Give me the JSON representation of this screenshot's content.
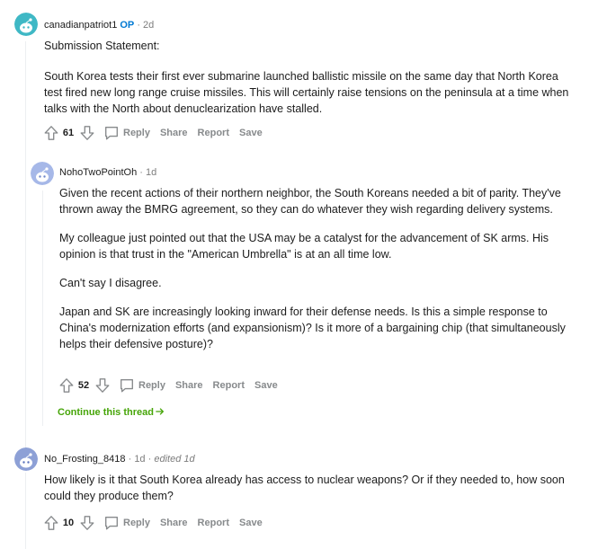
{
  "comments": [
    {
      "author": "canadianpatriot1",
      "op_badge": "OP",
      "sep": "·",
      "time": "2d",
      "paragraphs": [
        "Submission Statement:",
        "South Korea tests their first ever submarine launched ballistic missile on the same day that North Korea test fired new long range cruise missiles. This will certainly raise tensions on the peninsula at a time when talks with the North about denuclearization have stalled."
      ],
      "score": "61",
      "actions": {
        "reply": "Reply",
        "share": "Share",
        "report": "Report",
        "save": "Save"
      }
    },
    {
      "author": "NohoTwoPointOh",
      "sep": "·",
      "time": "1d",
      "paragraphs": [
        "Given the recent actions of their northern neighbor, the South Koreans needed a bit of parity. They've thrown away the BMRG agreement, so they can do whatever they wish regarding delivery systems.",
        "My colleague just pointed out that the USA may be a catalyst for the advancement of SK arms. His opinion is that trust in the \"American Umbrella\" is at an all time low.",
        "Can't say I disagree.",
        "Japan and SK are increasingly looking inward for their defense needs. Is this a simple response to China's modernization efforts (and expansionism)? Is it more of a bargaining chip (that simultaneously helps their defensive posture)?"
      ],
      "score": "52",
      "actions": {
        "reply": "Reply",
        "share": "Share",
        "report": "Report",
        "save": "Save"
      },
      "continue_thread": "Continue this thread"
    },
    {
      "author": "No_Frosting_8418",
      "sep": "·",
      "time": "1d",
      "sep2": "·",
      "edited": "edited 1d",
      "paragraphs": [
        "How likely is it that South Korea already has access to nuclear weapons? Or if they needed to, how soon could they produce them?"
      ],
      "score": "10",
      "actions": {
        "reply": "Reply",
        "share": "Share",
        "report": "Report",
        "save": "Save"
      }
    }
  ],
  "icons": {
    "upvote": "arrow-up-outline-icon",
    "downvote": "arrow-down-outline-icon",
    "reply": "speech-bubble-icon",
    "continue": "arrow-right-icon",
    "avatar": "snoo-avatar-icon"
  },
  "colors": {
    "op_badge": "#0079d3",
    "continue_link": "#46a508",
    "action_text": "#878a8c",
    "meta_dim": "#7c7c7c",
    "avatar1_bg": "#3fb8c5",
    "avatar2_bg": "#a6b8e8",
    "avatar3_bg": "#8da0d6"
  }
}
